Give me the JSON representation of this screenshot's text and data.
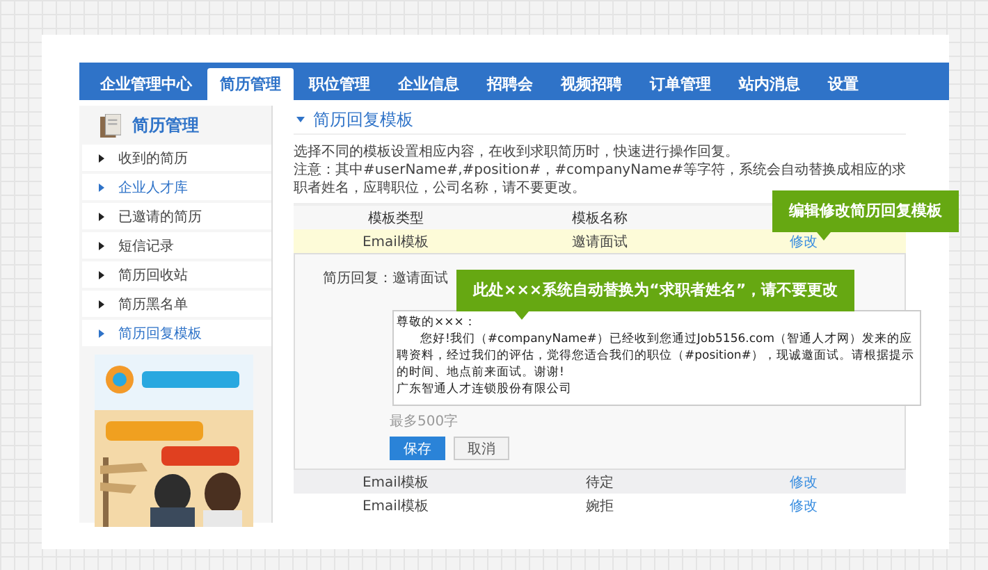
{
  "nav": {
    "tabs": [
      {
        "label": "企业管理中心",
        "selected": false
      },
      {
        "label": "简历管理",
        "selected": true
      },
      {
        "label": "职位管理",
        "selected": false
      },
      {
        "label": "企业信息",
        "selected": false
      },
      {
        "label": "招聘会",
        "selected": false
      },
      {
        "label": "视频招聘",
        "selected": false
      },
      {
        "label": "订单管理",
        "selected": false
      },
      {
        "label": "站内消息",
        "selected": false
      },
      {
        "label": "设置",
        "selected": false
      }
    ]
  },
  "sidebar": {
    "title": "简历管理",
    "items": [
      {
        "label": "收到的简历",
        "selected": false
      },
      {
        "label": "企业人才库",
        "selected": true
      },
      {
        "label": "已邀请的简历",
        "selected": false
      },
      {
        "label": "短信记录",
        "selected": false
      },
      {
        "label": "简历回收站",
        "selected": false
      },
      {
        "label": "简历黑名单",
        "selected": false
      },
      {
        "label": "简历回复模板",
        "selected": true
      }
    ]
  },
  "content": {
    "title": "简历回复模板",
    "intro": "选择不同的模板设置相应内容，在收到求职简历时，快速进行操作回复。",
    "note": "注意：其中#userName#,#position#，#companyName#等字符，系统会自动替换成相应的求职者姓名，应聘职位，公司名称，请不要更改。",
    "table": {
      "columns": [
        "模板类型",
        "模板名称"
      ],
      "rows": [
        {
          "type": "Email模板",
          "name": "邀请面试",
          "action": "修改",
          "selected": true
        },
        {
          "type": "Email模板",
          "name": "待定",
          "action": "修改",
          "selected": false
        },
        {
          "type": "Email模板",
          "name": "婉拒",
          "action": "修改",
          "selected": false
        }
      ]
    },
    "editor": {
      "label": "简历回复：邀请面试",
      "lines": [
        {
          "text": "尊敬的×××：",
          "indent": false
        },
        {
          "text": "您好!我们（#companyName#）已经收到您通过Job5156.com（智通人才网）发来的应聘资料，经过我们的评估，觉得您适合我们的职位（#position#），现诚邀面试。请根据提示的时间、地点前来面试。谢谢!",
          "indent": true
        },
        {
          "text": "广东智通人才连锁股份有限公司",
          "indent": false
        }
      ],
      "hint": "最多500字",
      "buttons": [
        {
          "label": "保存",
          "kind": "primary"
        },
        {
          "label": "取消",
          "kind": "secondary"
        }
      ]
    },
    "callouts": [
      {
        "text": "编辑修改简历回复模板",
        "kind": "table"
      },
      {
        "text": "此处×××系统自动替换为“求职者姓名”，请不要更改",
        "kind": "editor"
      }
    ]
  }
}
